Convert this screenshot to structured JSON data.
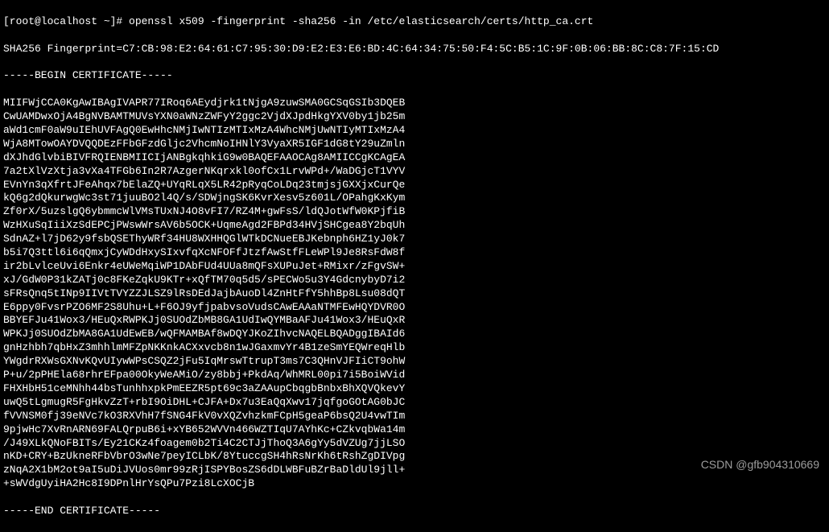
{
  "prompt": {
    "user_host_prefix": "[root@localhost ~]# ",
    "command": "openssl x509 -fingerprint -sha256 -in /etc/elasticsearch/certs/http_ca.crt"
  },
  "fingerprint_line": "SHA256 Fingerprint=C7:CB:98:E2:64:61:C7:95:30:D9:E2:E3:E6:BD:4C:64:34:75:50:F4:5C:B5:1C:9F:0B:06:BB:8C:C8:7F:15:CD",
  "cert_begin": "-----BEGIN CERTIFICATE-----",
  "cert_lines": [
    "MIIFWjCCA0KgAwIBAgIVAPR77IRoq6AEydjrk1tNjgA9zuwSMA0GCSqGSIb3DQEB",
    "CwUAMDwxOjA4BgNVBAMTMUVsYXN0aWNzZWFyY2ggc2VjdXJpdHkgYXV0by1jb25m",
    "aWd1cmF0aW9uIEhUVFAgQ0EwHhcNMjIwNTIzMTIxMzA4WhcNMjUwNTIyMTIxMzA4",
    "WjA8MTowOAYDVQQDEzFFbGFzdGljc2VhcmNoIHNlY3VyaXR5IGF1dG8tY29uZmln",
    "dXJhdGlvbiBIVFRQIENBMIICIjANBgkqhkiG9w0BAQEFAAOCAg8AMIICCgKCAgEA",
    "7a2tXlVzXtja3vXa4TFGb6In2R7AzgerNKqrxkl0ofCx1LrvWPd+/WaDGjcT1VYV",
    "EVnYn3qXfrtJFeAhqx7bElaZQ+UYqRLqX5LR42pRyqCoLDq23tmjsjGXXjxCurQe",
    "kQ6g2dQkurwgWc3st71juuBO2l4Q/s/SDWjngSK6KvrXesv5z601L/OPahgKxKym",
    "Zf0rX/5uzslgQ6ybmmcWlVMsTUxNJ4O8vFI7/RZ4M+gwFsS/ldQJotWfW0KPjfiB",
    "WzHXuSqIiiXzSdEPCjPWswWrsAV6b5OCK+UqmeAgd2FBPd34HVjSHCgea8Y2bqUh",
    "SdnAZ+l7jD62y9fsbQSEThyWRf34HU8WXHHQGlWTkDCNueEBJKebnph6HZ1yJ0k7",
    "b5i7Q3ttl6i6qQmxjCyWDdHxySIxvfqXcNFOFfJtzfAwStfFLeWPl9Je8RsFdW8f",
    "ir2bLvlceUvi6Enkr4eUWeMqiWP1DAbFUd4UUa8mQFsXUPuJet+RMixr/zFgvSW+",
    "xJ/GdW0P31kZATj0c8FKeZqkU9KTr+xQfTM70q5d5/sPECWo5u3Y4GdcnybyD7i2",
    "sFRsQnq5tINp9IIVtTVYZZJLSZ9lRsDEdJajbAuoDl4ZnHtFfY5hhBp8Lsu08dQT",
    "E6ppy0FvsrPZO6MF2S8Uhu+L+F6OJ9yfjpabvsoVudsCAwEAAaNTMFEwHQYDVR0O",
    "BBYEFJu41Wox3/HEuQxRWPKJj0SUOdZbMB8GA1UdIwQYMBaAFJu41Wox3/HEuQxR",
    "WPKJj0SUOdZbMA8GA1UdEwEB/wQFMAMBAf8wDQYJKoZIhvcNAQELBQADggIBAId6",
    "gnHzhbh7qbHxZ3mhhlmMFZpNKKnkACXxvcb8n1wJGaxmvYr4B1zeSmYEQWreqHlb",
    "YWgdrRXWsGXNvKQvUIywWPsCSQZ2jFu5IqMrswTtrupT3ms7C3QHnVJFIiCT9ohW",
    "P+u/2pPHEla68rhrEFpa00OkyWeAMiO/zy8bbj+PkdAq/WhMRL00pi7i5BoiWVid",
    "FHXHbH51ceMNhh44bsTunhhxpkPmEEZR5pt69c3aZAAupCbqgbBnbxBhXQVQkevY",
    "uwQ5tLgmugR5FgHkvZzT+rbI9OiDHL+CJFA+Dx7u3EaQqXwv17jqfgoGOtAG0bJC",
    "fVVNSM0fj39eNVc7kO3RXVhH7fSNG4FkV0vXQZvhzkmFCpH5geaP6bsQ2U4vwTIm",
    "9pjwHc7XvRnARN69FALQrpuB6i+xYB652WVVn466WZTIqU7AYhKc+CZkvqbWa14m",
    "/J49XLkQNoFBITs/Ey21CKz4foagem0b2Ti4C2CTJjThoQ3A6gYy5dVZUg7jjLSO",
    "nKD+CRY+BzUkneRFbVbrO3wNe7peyICLbK/8YtuccgSH4hRsNrKh6tRshZgDIVpg",
    "zNqA2X1bM2ot9aI5uDiJVUos0mr99zRjISPYBosZS6dDLWBFuBZrBaDldUl9jll+",
    "+sWVdgUyiHA2Hc8I9DPnlHrYsQPu7Pzi8LcXOCjB"
  ],
  "cert_end": "-----END CERTIFICATE-----",
  "watermark": "CSDN @gfb904310669"
}
